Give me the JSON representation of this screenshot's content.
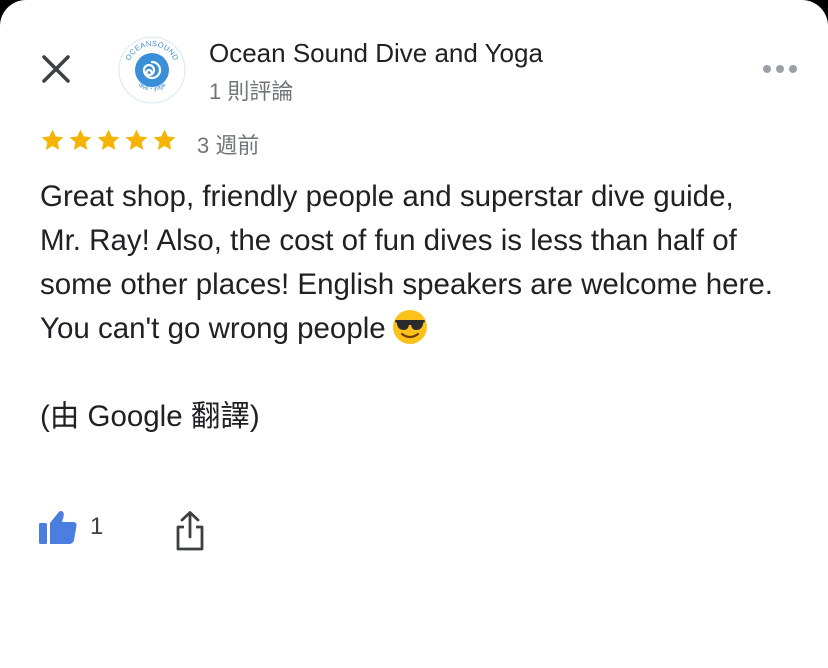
{
  "place": {
    "name": "Ocean Sound Dive and Yoga",
    "review_count": "1 則評論",
    "logo_text": "OCEANSOUND",
    "logo_subtext": "dive・yoga",
    "logo_color": "#3b8fd9"
  },
  "review": {
    "rating": 5,
    "star_color": "#f4b400",
    "time_ago": "3 週前",
    "text": "Great shop, friendly people and superstar dive guide, Mr. Ray! Also, the cost of fun dives is less than half of some other places! English speakers are welcome here. You can't go wrong people",
    "emoji": "smiling-face-with-sunglasses",
    "translation_note": "(由 Google 翻譯)"
  },
  "actions": {
    "like_count": "1",
    "like_color": "#4a7fe0",
    "close_icon": "close-icon",
    "more_icon": "more-horizontal-icon",
    "share_icon": "share-icon"
  }
}
